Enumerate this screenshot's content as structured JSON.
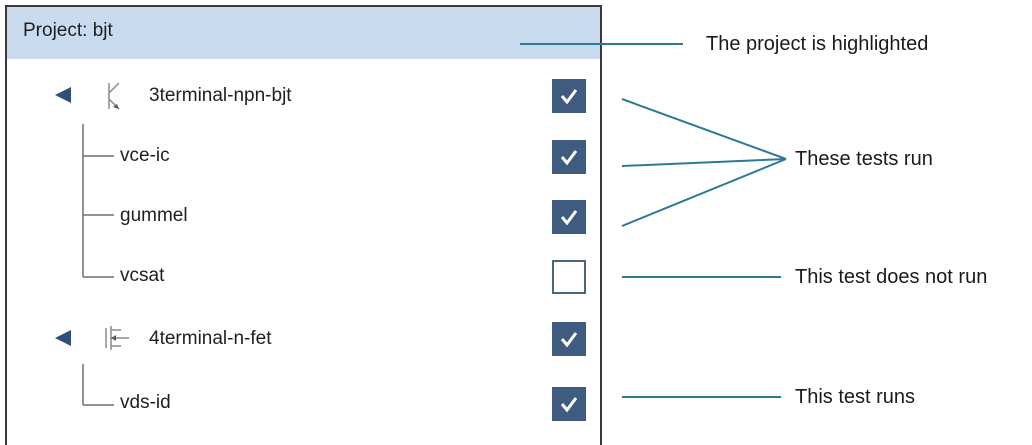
{
  "project": {
    "label": "Project: bjt"
  },
  "tree": {
    "group1": {
      "label": "3terminal-npn-bjt",
      "checked": true
    },
    "test_vce_ic": {
      "label": "vce-ic",
      "checked": true
    },
    "test_gummel": {
      "label": "gummel",
      "checked": true
    },
    "test_vcsat": {
      "label": "vcsat",
      "checked": false
    },
    "group2": {
      "label": "4terminal-n-fet",
      "checked": true
    },
    "test_vds_id": {
      "label": "vds-id",
      "checked": true
    }
  },
  "callouts": {
    "project_highlighted": "The project is highlighted",
    "tests_run": "These tests run",
    "test_not_run": "This test does not run",
    "test_runs": "This test runs"
  },
  "colors": {
    "header_highlight": "#c9dcef",
    "checkbox_checked": "#3f5c80",
    "callout_line": "#2b7a95"
  },
  "icons": {
    "expand": "triangle-left-icon",
    "bjt": "npn-transistor-icon",
    "fet": "n-fet-icon",
    "check": "checkmark-icon"
  }
}
